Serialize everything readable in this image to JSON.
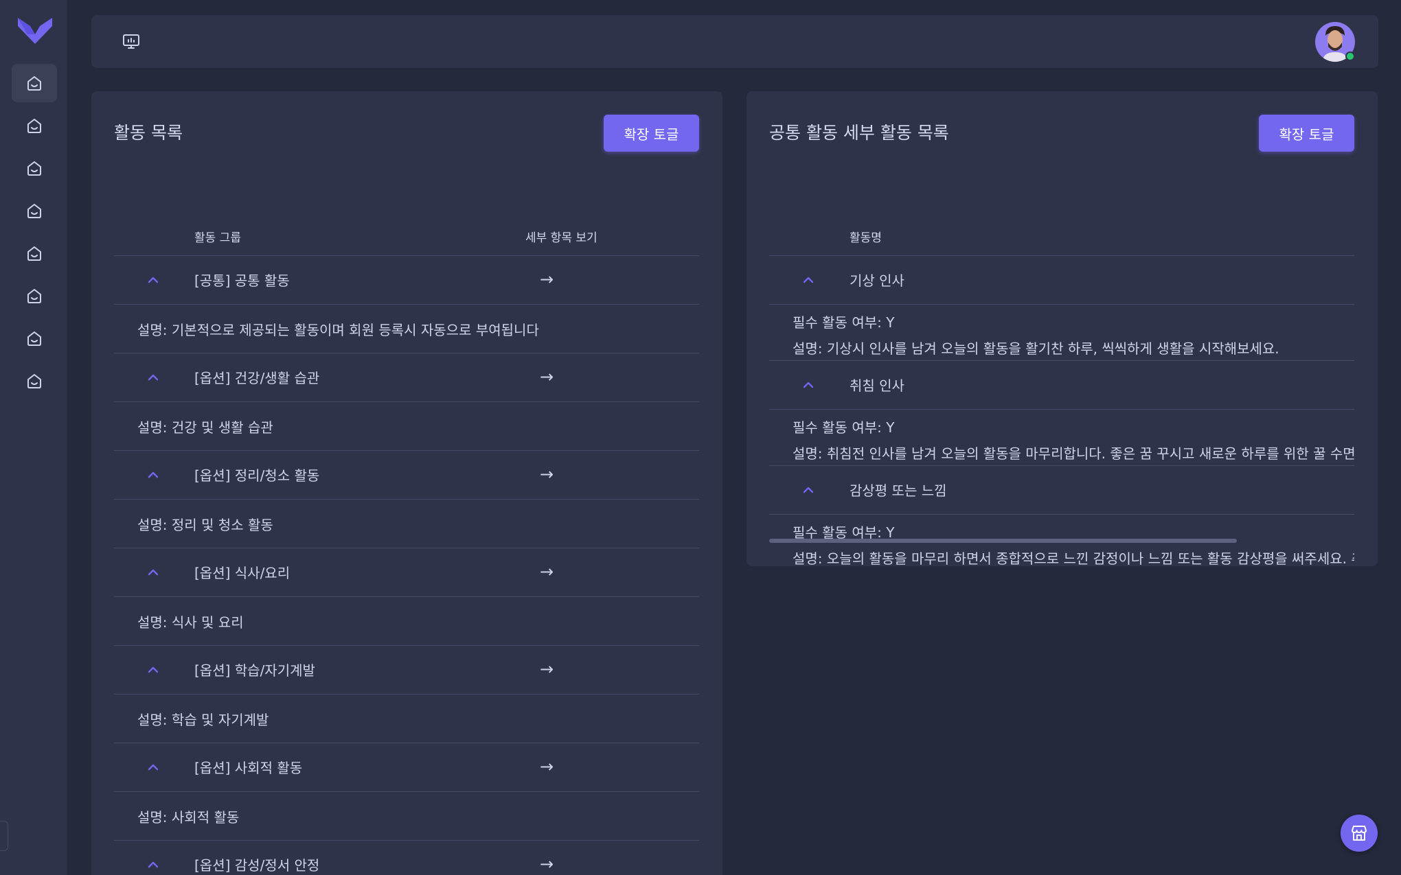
{
  "sidebar": {
    "logo_icon": "logo-v-icon",
    "items": [
      {
        "icon": "home-icon",
        "active": true
      },
      {
        "icon": "home-icon",
        "active": false
      },
      {
        "icon": "home-icon",
        "active": false
      },
      {
        "icon": "home-icon",
        "active": false
      },
      {
        "icon": "home-icon",
        "active": false
      },
      {
        "icon": "home-icon",
        "active": false
      },
      {
        "icon": "home-icon",
        "active": false
      },
      {
        "icon": "home-icon",
        "active": false
      }
    ]
  },
  "header": {
    "left_icon": "presentation-monitor-icon",
    "avatar_status": "online"
  },
  "activity_list": {
    "title": "활동 목록",
    "toggle_label": "확장 토글",
    "columns": [
      "활동 그룹",
      "세부 항목 보기"
    ],
    "rows": [
      {
        "name": "[공통] 공통 활동",
        "arrow": "→",
        "description": "설명: 기본적으로 제공되는 활동이며 회원 등록시 자동으로 부여됩니다"
      },
      {
        "name": "[옵션] 건강/생활 습관",
        "arrow": "→",
        "description": "설명: 건강 및 생활 습관"
      },
      {
        "name": "[옵션] 정리/청소 활동",
        "arrow": "→",
        "description": "설명: 정리 및 청소 활동"
      },
      {
        "name": "[옵션] 식사/요리",
        "arrow": "→",
        "description": "설명: 식사 및 요리"
      },
      {
        "name": "[옵션] 학습/자기계발",
        "arrow": "→",
        "description": "설명: 학습 및 자기계발"
      },
      {
        "name": "[옵션] 사회적 활동",
        "arrow": "→",
        "description": "설명: 사회적 활동"
      },
      {
        "name": "[옵션] 감성/정서 안정",
        "arrow": "→",
        "description": ""
      }
    ]
  },
  "detail_list": {
    "title": "공통 활동 세부 활동 목록",
    "toggle_label": "확장 토글",
    "columns": [
      "활동명"
    ],
    "rows": [
      {
        "name": "기상 인사",
        "required": "필수 활동 여부: Y",
        "description": "설명: 기상시 인사를 남겨 오늘의 활동을 활기찬 하루, 씩씩하게 생활을 시작해보세요."
      },
      {
        "name": "취침 인사",
        "required": "필수 활동 여부: Y",
        "description": "설명: 취침전 인사를 남겨 오늘의 활동을 마무리합니다. 좋은 꿈 꾸시고 새로운 하루를 위한 꿀 수면을"
      },
      {
        "name": "감상평 또는 느낌",
        "required": "필수 활동 여부: Y",
        "description": "설명: 오늘의 활동을 마무리 하면서 종합적으로 느낀 감정이나 느낌 또는 활동 감상평을 써주세요. 추가"
      }
    ]
  },
  "fab": {
    "icon": "store-icon"
  },
  "colors": {
    "accent": "#7367f0",
    "background": "#25293c",
    "surface": "#2f3349",
    "online": "#28c76f"
  }
}
